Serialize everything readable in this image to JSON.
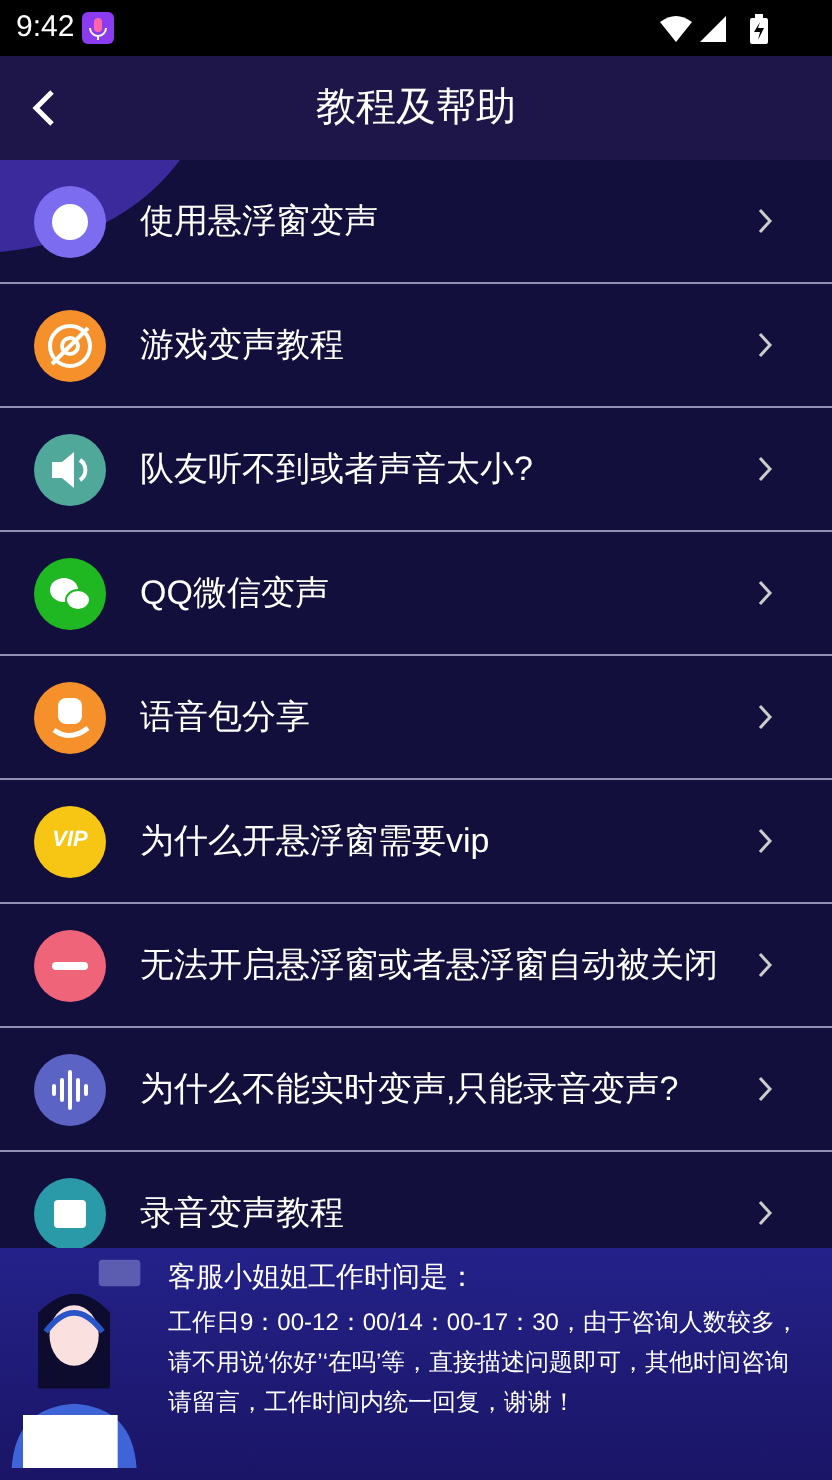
{
  "status_bar": {
    "time": "9:42"
  },
  "header": {
    "title": "教程及帮助"
  },
  "items": [
    {
      "label": "使用悬浮窗变声",
      "kind": "float",
      "color": "#7b6cf0"
    },
    {
      "label": "游戏变声教程",
      "kind": "game",
      "color": "#f5902a"
    },
    {
      "label": "队友听不到或者声音太小?",
      "kind": "speaker",
      "color": "#4fa89a"
    },
    {
      "label": "QQ微信变声",
      "kind": "chat",
      "color": "#1fb823"
    },
    {
      "label": "语音包分享",
      "kind": "hand",
      "color": "#f5902a"
    },
    {
      "label": "为什么开悬浮窗需要vip",
      "kind": "vip",
      "color": "#f7c513",
      "icon_text": "VIP"
    },
    {
      "label": "无法开启悬浮窗或者悬浮窗自动被关闭",
      "kind": "minus",
      "color": "#ef6478"
    },
    {
      "label": "为什么不能实时变声,只能录音变声?",
      "kind": "wave",
      "color": "#5b63c4"
    },
    {
      "label": "录音变声教程",
      "kind": "record",
      "color": "#2a9aa8"
    }
  ],
  "notice": {
    "title": "客服小姐姐工作时间是：",
    "body": "工作日9：00-12：00/14：00-17：30，由于咨询人数较多，请不用说‘你好’‘在吗’等，直接描述问题即可，其他时间咨询请留言，工作时间内统一回复，谢谢！"
  }
}
